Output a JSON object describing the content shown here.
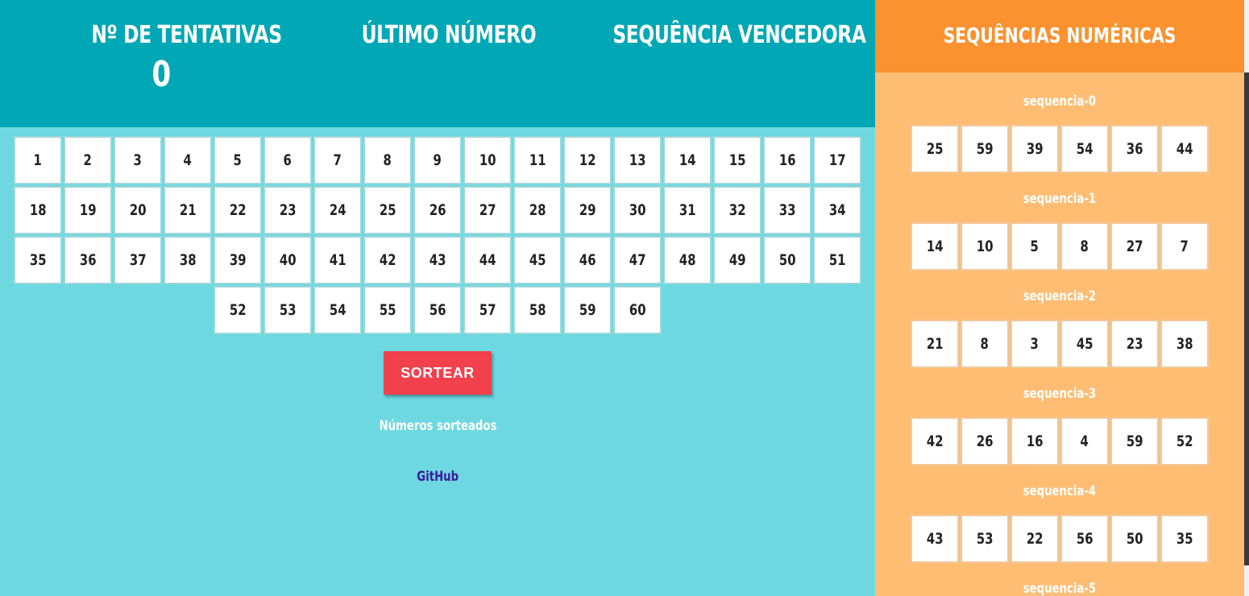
{
  "header": {
    "tentativas_label": "Nº DE TENTATIVAS",
    "tentativas_value": "0",
    "ultimo_label": "ÚLTIMO NÚMERO",
    "ultimo_value": "",
    "vencedora_label": "SEQUÊNCIA VENCEDORA",
    "vencedora_value": ""
  },
  "numbers": [
    "1",
    "2",
    "3",
    "4",
    "5",
    "6",
    "7",
    "8",
    "9",
    "10",
    "11",
    "12",
    "13",
    "14",
    "15",
    "16",
    "17",
    "18",
    "19",
    "20",
    "21",
    "22",
    "23",
    "24",
    "25",
    "26",
    "27",
    "28",
    "29",
    "30",
    "31",
    "32",
    "33",
    "34",
    "35",
    "36",
    "37",
    "38",
    "39",
    "40",
    "41",
    "42",
    "43",
    "44",
    "45",
    "46",
    "47",
    "48",
    "49",
    "50",
    "51",
    "52",
    "53",
    "54",
    "55",
    "56",
    "57",
    "58",
    "59",
    "60"
  ],
  "draw_button_label": "SORTEAR",
  "drawn_title": "Números sorteados",
  "github_label": "GitHub",
  "sidebar": {
    "title": "SEQUÊNCIAS NUMÉRICAS",
    "sequences": [
      {
        "title": "sequencia-0",
        "values": [
          "25",
          "59",
          "39",
          "54",
          "36",
          "44"
        ]
      },
      {
        "title": "sequencia-1",
        "values": [
          "14",
          "10",
          "5",
          "8",
          "27",
          "7"
        ]
      },
      {
        "title": "sequencia-2",
        "values": [
          "21",
          "8",
          "3",
          "45",
          "23",
          "38"
        ]
      },
      {
        "title": "sequencia-3",
        "values": [
          "42",
          "26",
          "16",
          "4",
          "59",
          "52"
        ]
      },
      {
        "title": "sequencia-4",
        "values": [
          "43",
          "53",
          "22",
          "56",
          "50",
          "35"
        ]
      },
      {
        "title": "sequencia-5",
        "values": []
      }
    ]
  },
  "colors": {
    "header_bg": "#00a7b4",
    "main_bg": "#6dd8e0",
    "sidebar_header_bg": "#f9922f",
    "sidebar_bg": "#ffbd74",
    "button_bg": "#f2404c"
  }
}
